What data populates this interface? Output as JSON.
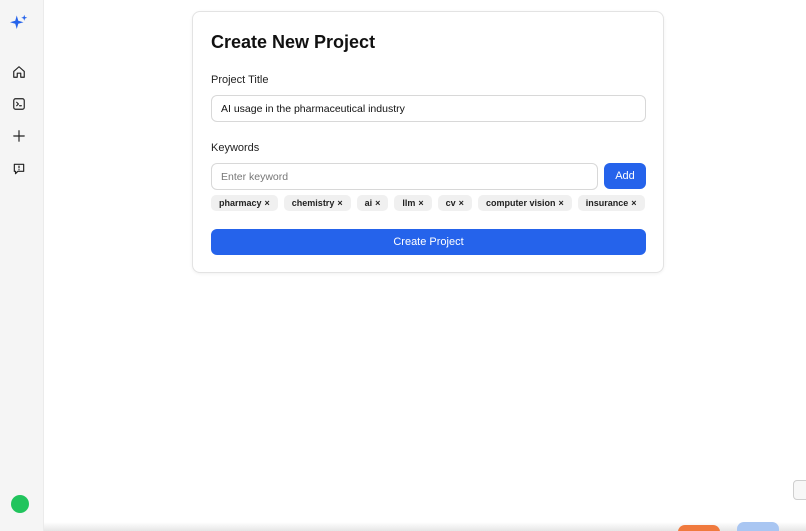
{
  "sidebar": {
    "items": [
      {
        "icon": "sparkle-logo-icon"
      },
      {
        "icon": "home-icon"
      },
      {
        "icon": "terminal-icon"
      },
      {
        "icon": "plus-icon"
      },
      {
        "icon": "feedback-icon"
      }
    ],
    "status_color": "#21c45d",
    "accent": "#2563eb"
  },
  "form": {
    "title": "Create New Project",
    "project_title_label": "Project Title",
    "project_title_value": "AI usage in the pharmaceutical industry",
    "keywords_label": "Keywords",
    "keyword_placeholder": "Enter keyword",
    "add_label": "Add",
    "keywords": [
      "pharmacy",
      "chemistry",
      "ai",
      "llm",
      "cv",
      "computer vision",
      "insurance"
    ],
    "remove_glyph": "×",
    "submit_label": "Create Project"
  }
}
